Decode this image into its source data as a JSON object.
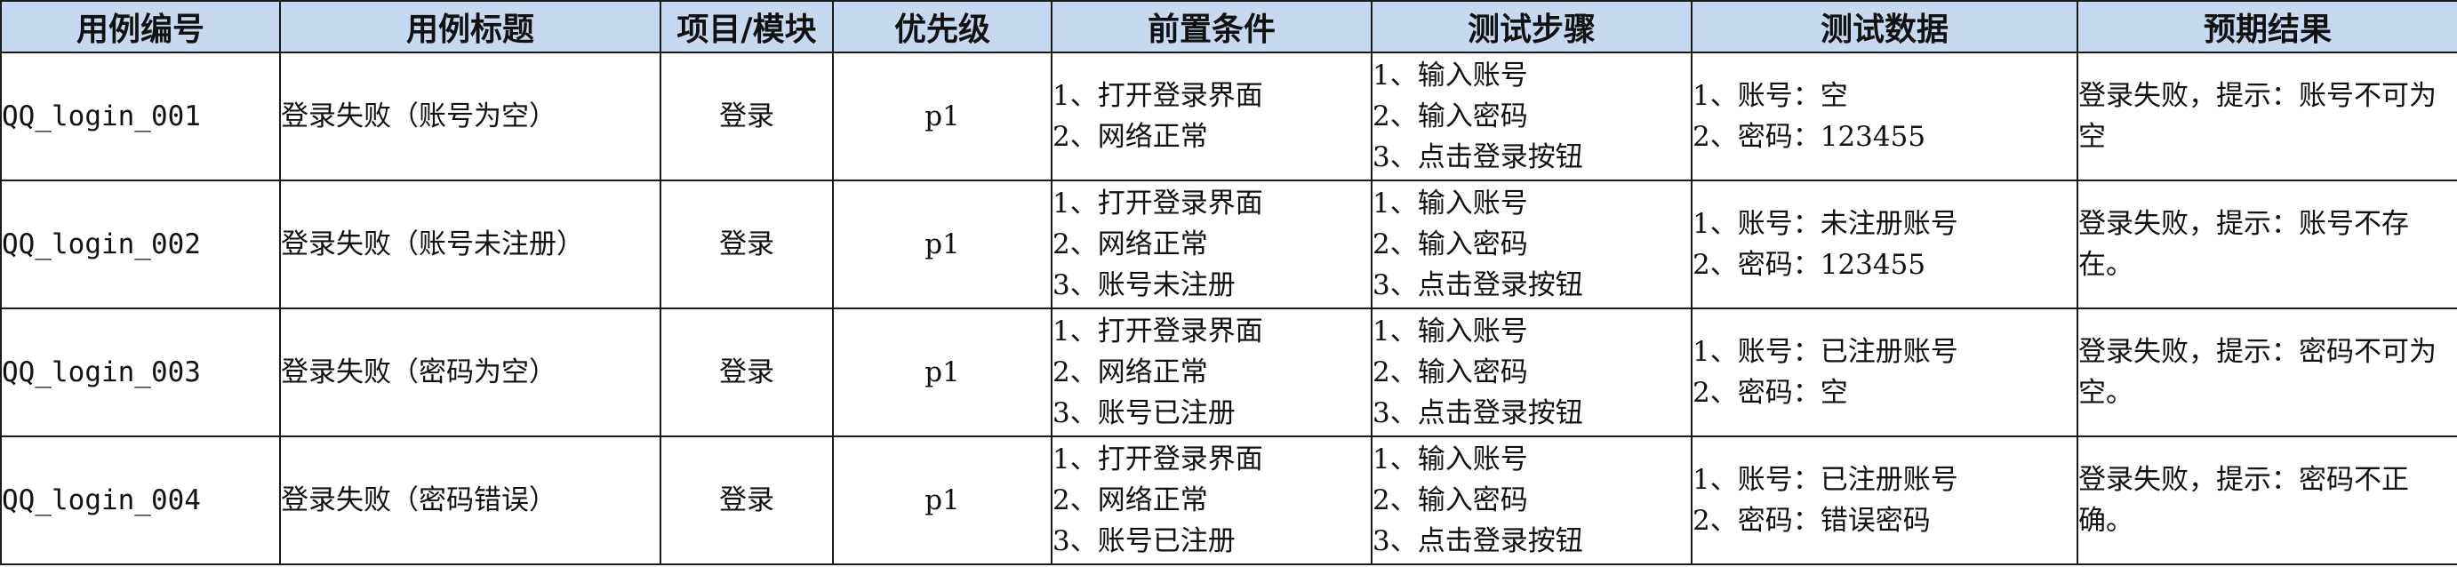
{
  "headers": {
    "case_id": "用例编号",
    "case_title": "用例标题",
    "module": "项目/模块",
    "priority": "优先级",
    "preconditions": "前置条件",
    "steps": "测试步骤",
    "test_data": "测试数据",
    "expected": "预期结果"
  },
  "rows": [
    {
      "case_id": "QQ_login_001",
      "case_title": "登录失败（账号为空）",
      "module": "登录",
      "priority": "p1",
      "preconditions": [
        "1、打开登录界面",
        "2、网络正常"
      ],
      "steps": [
        "1、输入账号",
        "2、输入密码",
        "3、点击登录按钮"
      ],
      "test_data": [
        "1、账号：空",
        "2、密码：123455"
      ],
      "expected": "登录失败，提示：账号不可为空"
    },
    {
      "case_id": "QQ_login_002",
      "case_title": "登录失败（账号未注册）",
      "module": "登录",
      "priority": "p1",
      "preconditions": [
        "1、打开登录界面",
        "2、网络正常",
        "3、账号未注册"
      ],
      "steps": [
        "1、输入账号",
        "2、输入密码",
        "3、点击登录按钮"
      ],
      "test_data": [
        "1、账号：未注册账号",
        "2、密码：123455"
      ],
      "expected": "登录失败，提示：账号不存在。"
    },
    {
      "case_id": "QQ_login_003",
      "case_title": "登录失败（密码为空）",
      "module": "登录",
      "priority": "p1",
      "preconditions": [
        "1、打开登录界面",
        "2、网络正常",
        "3、账号已注册"
      ],
      "steps": [
        "1、输入账号",
        "2、输入密码",
        "3、点击登录按钮"
      ],
      "test_data": [
        "1、账号：已注册账号",
        "2、密码：空"
      ],
      "expected": "登录失败，提示：密码不可为空。"
    },
    {
      "case_id": "QQ_login_004",
      "case_title": "登录失败（密码错误）",
      "module": "登录",
      "priority": "p1",
      "preconditions": [
        "1、打开登录界面",
        "2、网络正常",
        "3、账号已注册"
      ],
      "steps": [
        "1、输入账号",
        "2、输入密码",
        "3、点击登录按钮"
      ],
      "test_data": [
        "1、账号：已注册账号",
        "2、密码：错误密码"
      ],
      "expected": "登录失败，提示：密码不正确。"
    }
  ]
}
